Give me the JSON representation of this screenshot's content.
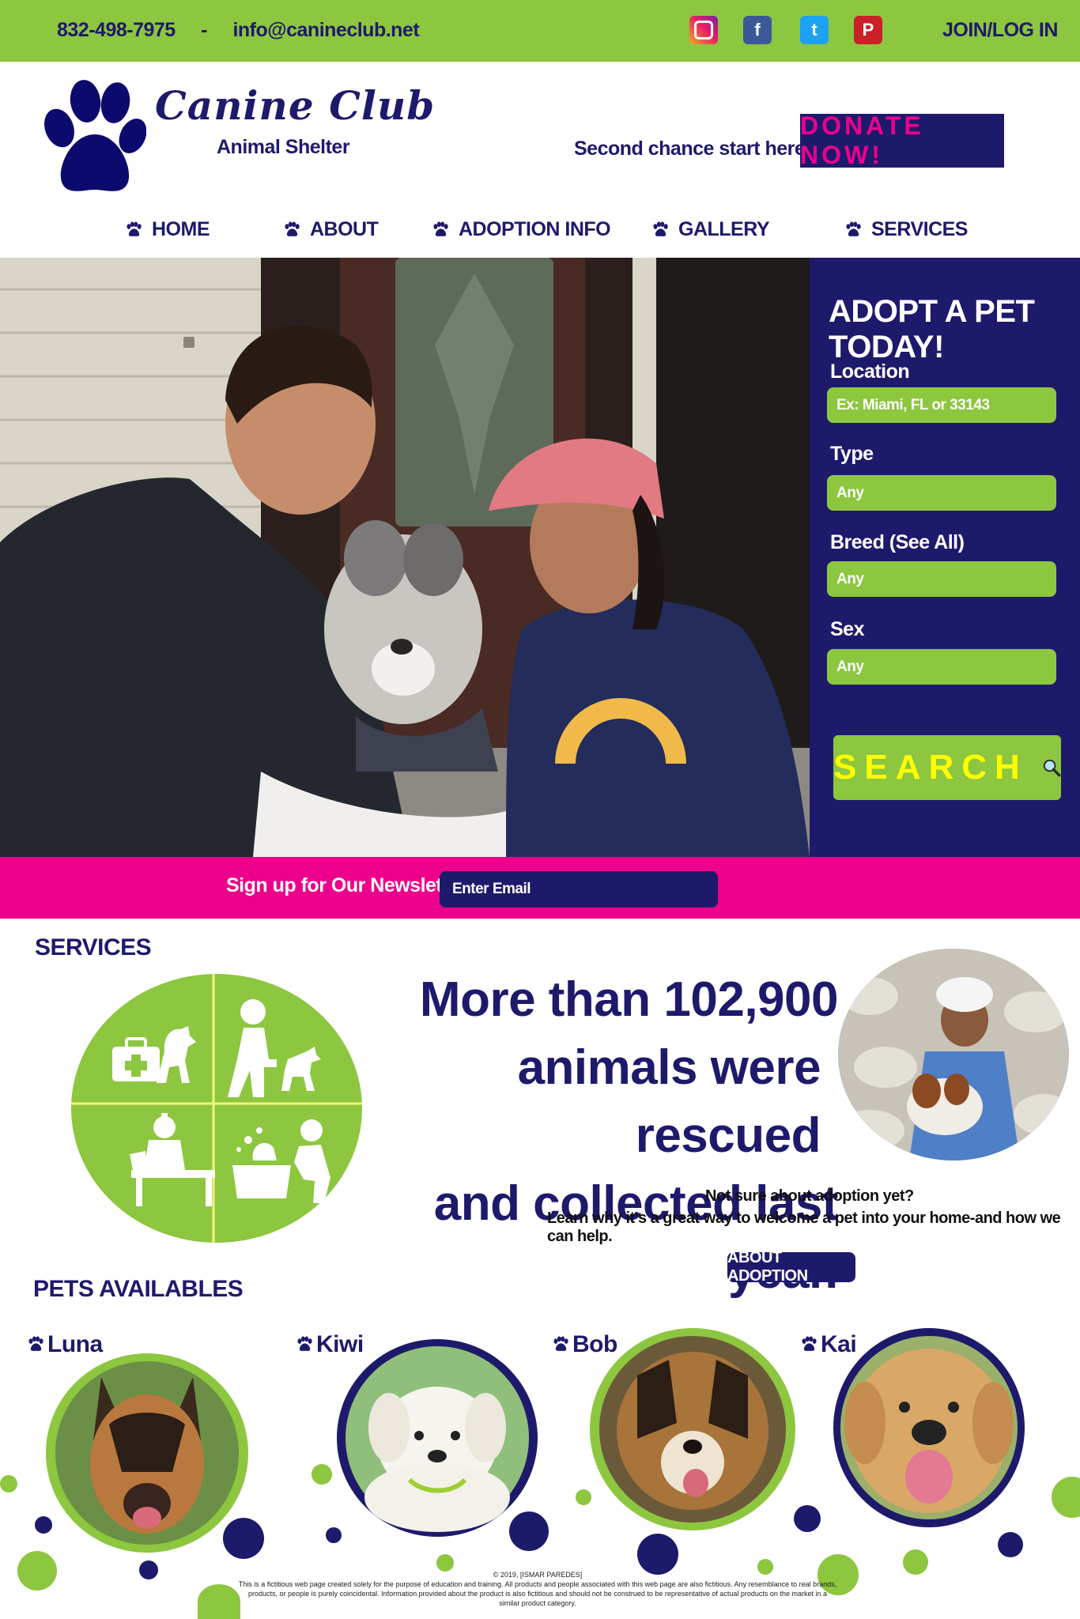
{
  "topbar": {
    "phone": "832-498-7975",
    "separator": "-",
    "email": "info@canineclub.net",
    "social": [
      {
        "icon": "instagram-icon"
      },
      {
        "icon": "facebook-icon",
        "glyph": "f"
      },
      {
        "icon": "twitter-icon",
        "glyph": "t"
      },
      {
        "icon": "pinterest-icon",
        "glyph": "P"
      }
    ],
    "join_label": "JOIN/LOG IN"
  },
  "header": {
    "brand": "Canine Club",
    "subbrand": "Animal Shelter",
    "tagline": "Second chance start here",
    "donate_label": "DONATE NOW!"
  },
  "nav": [
    "HOME",
    "ABOUT",
    "ADOPTION INFO",
    "GALLERY",
    "SERVICES"
  ],
  "adopt": {
    "title": "ADOPT A PET TODAY!",
    "location_label": "Location",
    "location_placeholder": "Ex: Miami, FL or 33143",
    "type_label": "Type",
    "type_value": "Any",
    "breed_label": "Breed (See All)",
    "breed_value": "Any",
    "sex_label": "Sex",
    "sex_value": "Any",
    "search_label": "SEARCH"
  },
  "newsletter": {
    "label": "Sign up for Our Newsletter",
    "placeholder": "Enter Email"
  },
  "services": {
    "heading": "SERVICES",
    "stat_lines": [
      "More than 102,900",
      "animals were rescued",
      "and collected last year."
    ],
    "adopt_question": "Not sure about adoption yet?",
    "adopt_text": "Learn why it's a great way to welcome a pet into your home-and how we can help.",
    "about_button": "ABOUT ADOPTION"
  },
  "pets": {
    "heading": "PETS AVAILABLES",
    "names": [
      "Luna",
      "Kiwi",
      "Bob",
      "Kai"
    ]
  },
  "footer": {
    "copyright": "© 2019, [ISMAR PAREDES]",
    "disclaimer": "This is a fictitious web page created solely for the purpose of education and training. All products and people associated with this web page are also fictitious. Any resemblance to real brands, products, or people is purely coincidental. Information provided about the product is also fictitious and should not be construed to be representative of actual products on the market in a similar product category."
  },
  "colors": {
    "green": "#8dc63f",
    "navy": "#1e1a6b",
    "magenta": "#ec008c",
    "yellow": "#ffff00"
  }
}
